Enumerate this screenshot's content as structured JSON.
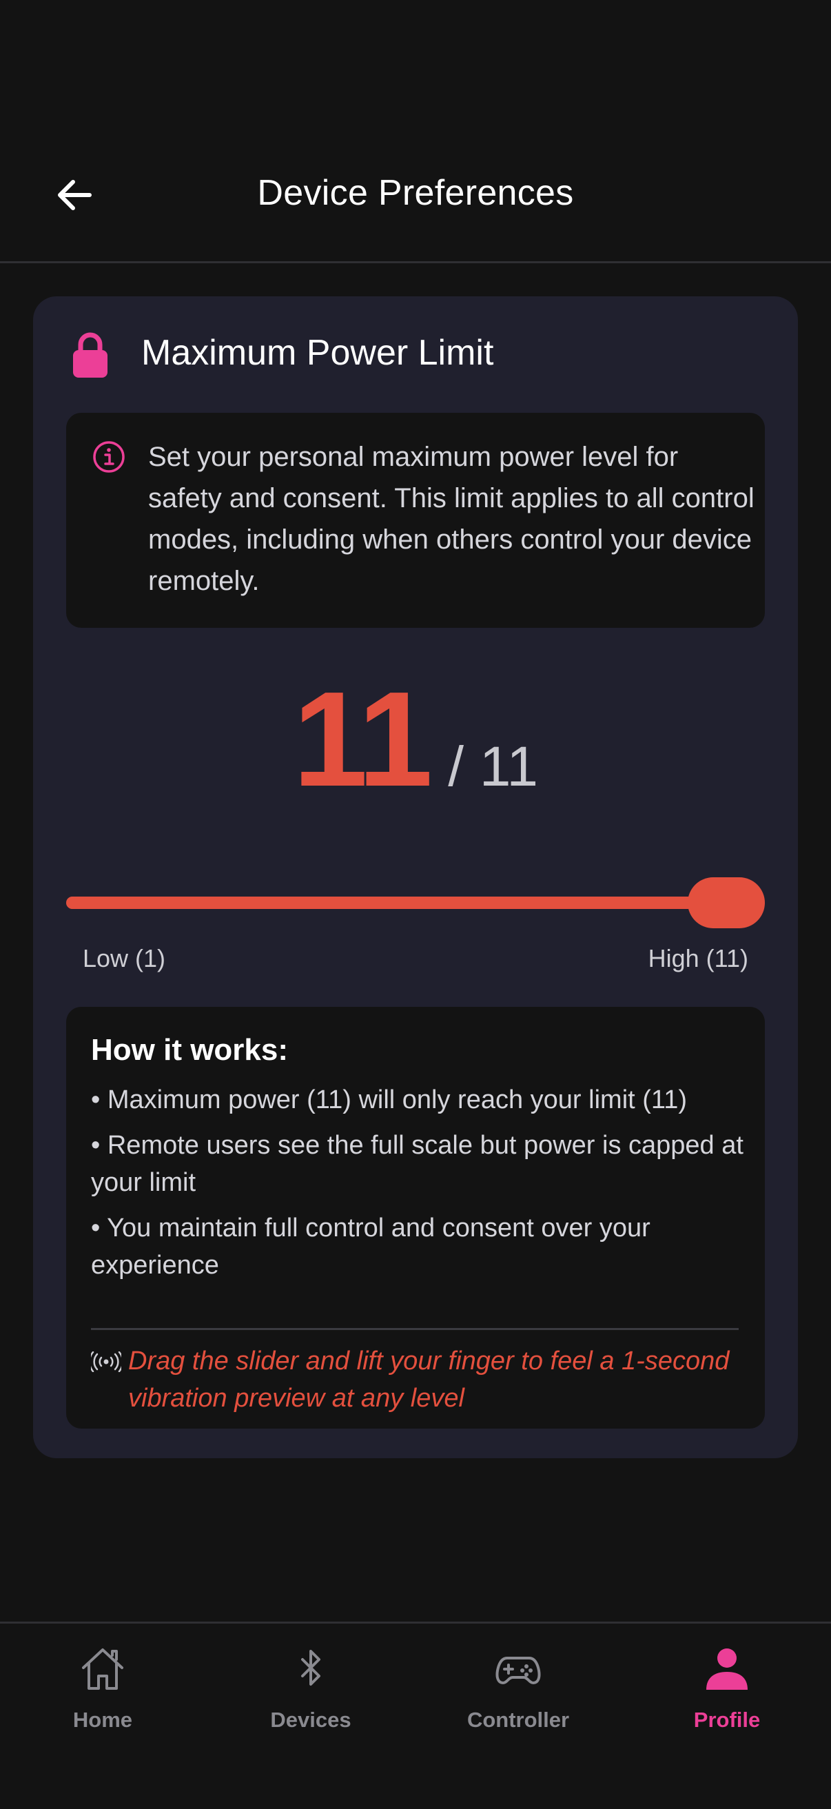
{
  "header": {
    "title": "Device Preferences",
    "back_icon": "arrow-left-icon"
  },
  "card": {
    "title": "Maximum Power Limit",
    "icon": "lock-icon",
    "info": {
      "icon": "info-icon",
      "text": "Set your personal maximum power level for safety and consent. This limit applies to all control modes, including when others control your device remotely."
    },
    "power": {
      "value": "11",
      "max_label": "/ 11"
    },
    "slider": {
      "min": 1,
      "max": 11,
      "value": 11,
      "low_label": "Low (1)",
      "high_label": "High (11)"
    },
    "how_it_works": {
      "title": "How it works:",
      "items": [
        "• Maximum power (11) will only reach your limit (11)",
        "• Remote users see the full scale but power is capped at your limit",
        "• You maintain full control and consent over your experience"
      ],
      "preview_icon": "vibration-icon",
      "preview_text": "Drag the slider and lift your finger to feel a 1-second vibration preview at any level"
    }
  },
  "bottom_nav": {
    "items": [
      {
        "label": "Home",
        "icon": "home-icon",
        "active": false
      },
      {
        "label": "Devices",
        "icon": "bluetooth-icon",
        "active": false
      },
      {
        "label": "Controller",
        "icon": "gamepad-icon",
        "active": false
      },
      {
        "label": "Profile",
        "icon": "user-icon",
        "active": true
      }
    ]
  },
  "colors": {
    "background": "#131313",
    "card": "#20202e",
    "accent_red": "#e4503e",
    "accent_pink": "#ec3f97",
    "muted": "#8a8a90"
  }
}
